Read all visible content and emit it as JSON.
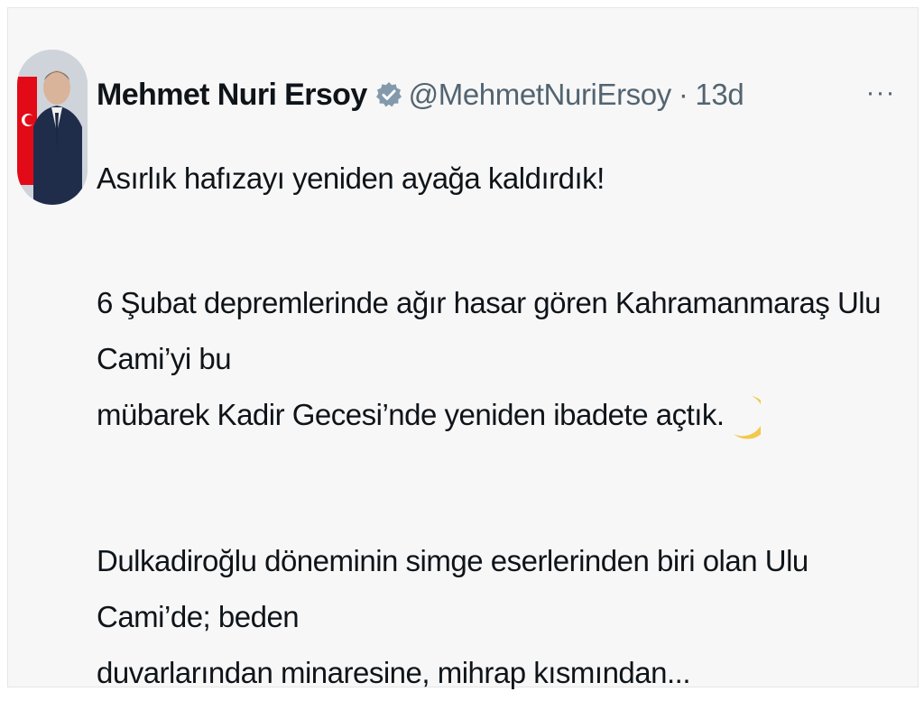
{
  "post": {
    "author": {
      "name": "Mehmet Nuri Ersoy",
      "handle": "@MehmetNuriErsoy",
      "verified_icon": "verified-badge-icon",
      "avatar_icon": "profile-photo"
    },
    "separator": "·",
    "time": "13d",
    "more_label": "···",
    "text": {
      "line1": "Asırlık hafızayı yeniden ayağa kaldırdık!",
      "line2": "6 Şubat depremlerinde ağır hasar gören Kahramanmaraş Ulu Cami’yi bu",
      "line3": "mübarek Kadir Gecesi’nde yeniden ibadete açtık.",
      "emoji": "crescent-moon-icon",
      "line4": "Dulkadiroğlu döneminin simge eserlerinden biri olan Ulu Cami’de; beden",
      "line5": "duvarlarından minaresine, mihrap kısmından..."
    }
  },
  "colors": {
    "background": "#f7f7f7",
    "text": "#0f1419",
    "secondary": "#536471",
    "badge": "#829aab",
    "flag_red": "#e30a17"
  }
}
